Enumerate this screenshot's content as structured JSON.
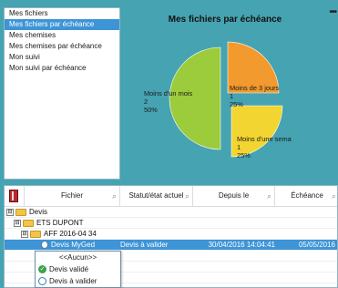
{
  "nav": {
    "items": [
      {
        "label": "Mes fichiers",
        "selected": false
      },
      {
        "label": "Mes fichiers par échéance",
        "selected": true
      },
      {
        "label": "Mes chemises",
        "selected": false
      },
      {
        "label": "Mes chemises par échéance",
        "selected": false
      },
      {
        "label": "Mon suivi",
        "selected": false
      },
      {
        "label": "Mon suivi par échéance",
        "selected": false
      }
    ]
  },
  "chart": {
    "menu_icon": "more-dots",
    "title": "Mes fichiers par échéance"
  },
  "chart_data": {
    "type": "pie",
    "title": "Mes fichiers par échéance",
    "slices": [
      {
        "label": "Moins d'un mois",
        "value": 2,
        "percent": "50%",
        "color": "#9ccb3b"
      },
      {
        "label": "Moins de 3 jours",
        "value": 1,
        "percent": "25%",
        "color": "#f29a2e"
      },
      {
        "label": "Moins d'une sema",
        "value": 1,
        "percent": "25%",
        "color": "#f2d531"
      }
    ]
  },
  "grid": {
    "header_icon": "book-icon",
    "columns": [
      {
        "label": "Fichier"
      },
      {
        "label": "Statut/état actuel"
      },
      {
        "label": "Depuis le"
      },
      {
        "label": "Échéance"
      }
    ],
    "rows": [
      {
        "name": "Devis",
        "statut": "",
        "depuis": "",
        "echeance": ""
      },
      {
        "name": "ETS DUPONT",
        "statut": "",
        "depuis": "",
        "echeance": ""
      },
      {
        "name": "AFF 2016-04 34",
        "statut": "",
        "depuis": "",
        "echeance": ""
      },
      {
        "name": "Devis MyGed",
        "statut": "Devis à valider",
        "depuis": "30/04/2016 14:04:41",
        "echeance": "05/05/2016"
      }
    ],
    "toggles": [
      "⊟",
      "⊟",
      "⊟"
    ]
  },
  "dropdown": {
    "options": [
      {
        "label": "<<Aucun>>"
      },
      {
        "label": "Devis validé",
        "icon": "check-icon"
      },
      {
        "label": "Devis à valider",
        "icon": "clock-icon"
      }
    ]
  }
}
